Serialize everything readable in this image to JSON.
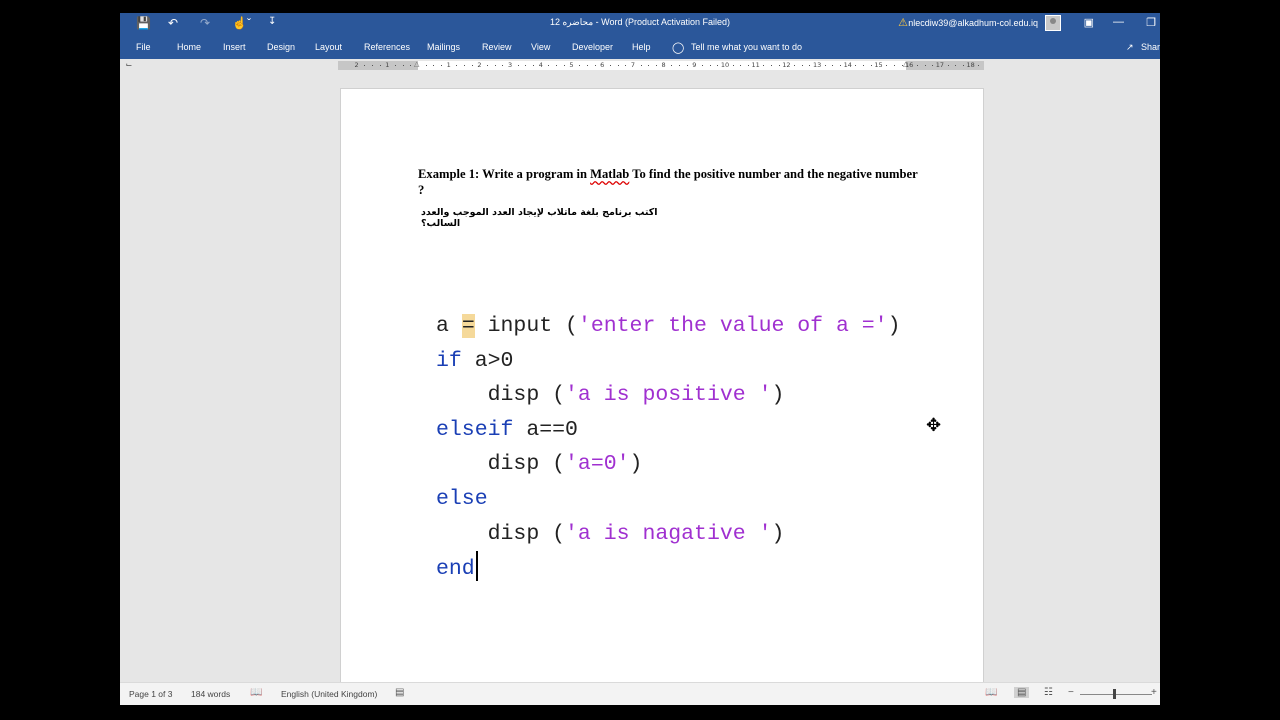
{
  "titlebar": {
    "title": "محاضره 12 - Word (Product Activation Failed)",
    "account": "nlecdiw39@alkadhum-col.edu.iq",
    "qat": {
      "save_icon": "save-icon",
      "undo_icon": "undo-icon",
      "redo_icon": "redo-icon",
      "touch_icon": "touch-mode-icon",
      "customize_icon": "customize-qat-icon"
    },
    "window_controls": [
      "ribbon-display-icon",
      "minimize-icon",
      "restore-icon"
    ]
  },
  "ribbon": {
    "tabs": [
      "File",
      "Home",
      "Insert",
      "Design",
      "Layout",
      "References",
      "Mailings",
      "Review",
      "View",
      "Developer",
      "Help"
    ],
    "tell_me": "Tell me what you want to do",
    "share": "Share"
  },
  "ruler": {
    "left_numbers": [
      "2",
      "1"
    ],
    "right_numbers": [
      "1",
      "2",
      "3",
      "4",
      "5",
      "6",
      "7",
      "8",
      "9",
      "10",
      "11",
      "12",
      "13",
      "14",
      "15",
      "16",
      "17",
      "18"
    ]
  },
  "document": {
    "heading_before": "Example 1: Write a program in ",
    "heading_underlined": "Matlab",
    "heading_after": " To find the positive number and the negative number ?",
    "arabic": "اكتب برنامج بلغة ماتلاب لإيجاد العدد الموجب والعدد السالب؟",
    "code": {
      "l1_var": "a ",
      "l1_eq": "=",
      "l1_func": " input (",
      "l1_str": "'enter the value of a ='",
      "l1_close": ")",
      "l2_kw": "if",
      "l2_rest": " a>0",
      "l3_func": "    disp (",
      "l3_str": "'a is positive '",
      "l3_close": ")",
      "l4_kw": "elseif",
      "l4_rest": " a==0",
      "l5_func": "    disp (",
      "l5_str": "'a=0'",
      "l5_close": ")",
      "l6_kw": "else",
      "l7_func": "    disp (",
      "l7_str": "'a is nagative '",
      "l7_close": ")",
      "l8_kw": "end"
    }
  },
  "statusbar": {
    "page": "Page 1 of 3",
    "words": "184 words",
    "language": "English (United Kingdom)"
  },
  "colors": {
    "ribbon_blue": "#2b579a",
    "keyword_blue": "#1a3fb5",
    "string_purple": "#a030d0"
  }
}
